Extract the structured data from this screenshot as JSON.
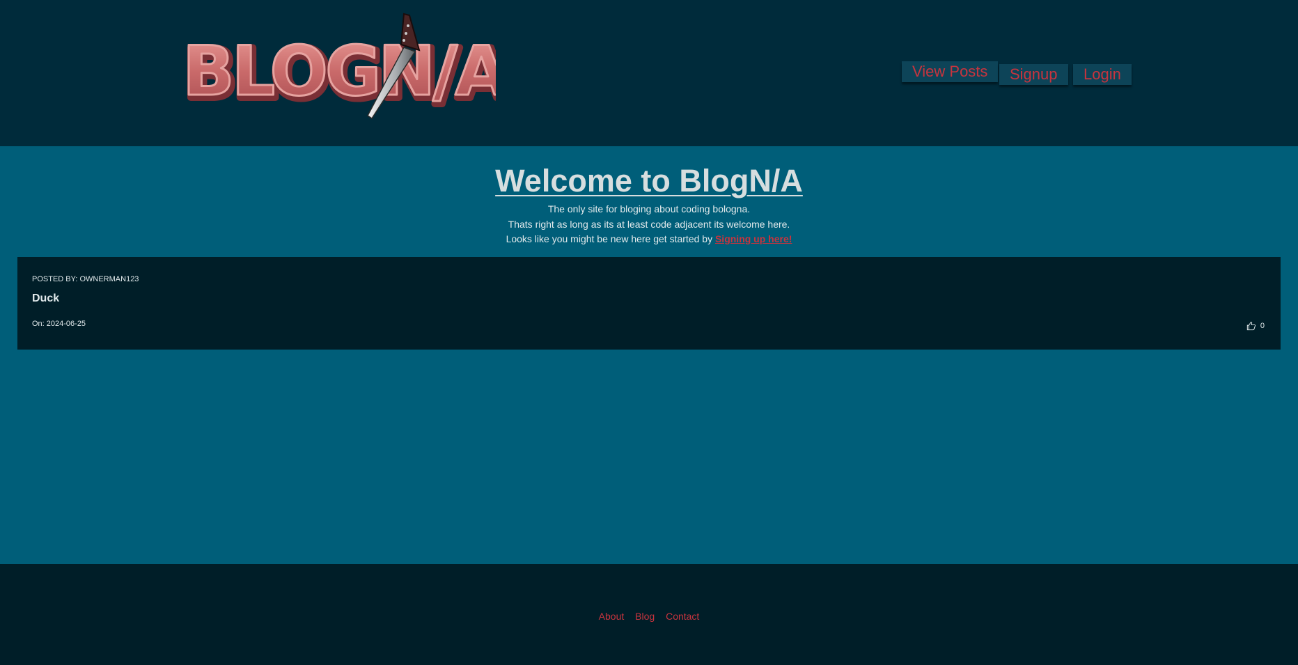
{
  "header": {
    "logo_text": "BLOGN/A",
    "nav": {
      "view_posts": "View Posts",
      "signup": "Signup",
      "login": "Login"
    }
  },
  "main": {
    "title": "Welcome to BlogN/A",
    "intro": {
      "line1": "The only site for bloging about coding bologna.",
      "line2": "Thats right as long as its at least code adjacent its welcome here.",
      "line3_prefix": "Looks like you might be new here get started by ",
      "line3_link": "Signing up here!"
    },
    "posts": [
      {
        "author_label": "POSTED BY: OWNERMAN123",
        "title": "Duck",
        "date_label": "On: 2024-06-25",
        "likes": "0"
      }
    ]
  },
  "footer": {
    "links": [
      "About",
      "Blog",
      "Contact"
    ]
  },
  "colors": {
    "header_bg": "#002b3b",
    "main_bg": "#005e79",
    "dark_bg": "#001e28",
    "accent": "#c8343e",
    "logo_fill": "#d47272"
  },
  "icons": {
    "like": "thumbs-up-icon",
    "knife": "knife-icon"
  }
}
